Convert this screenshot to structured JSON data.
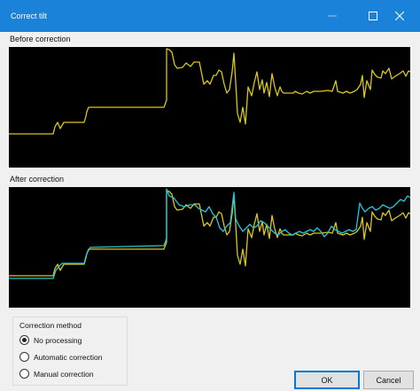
{
  "window": {
    "title": "Correct tilt",
    "title_bar_color": "#1a82d9"
  },
  "sections": {
    "before_label": "Before correction",
    "after_label": "After correction"
  },
  "graph": {
    "background_color": "#000000",
    "original_profile_color": "#d9c81a",
    "corrected_profile_color": "#25c6d9"
  },
  "correction_method": {
    "group_title": "Correction method",
    "options": [
      {
        "label": "No processing",
        "selected": true
      },
      {
        "label": "Automatic correction",
        "selected": false
      },
      {
        "label": "Manual correction",
        "selected": false
      }
    ]
  },
  "buttons": {
    "ok_label": "OK",
    "cancel_label": "Cancel"
  },
  "icons": {
    "minimize": "minimize-icon",
    "maximize": "maximize-icon",
    "close": "close-icon"
  }
}
